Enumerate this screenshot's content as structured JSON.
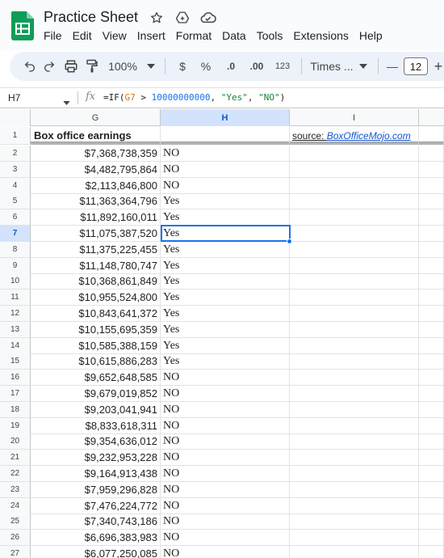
{
  "app": {
    "doc_title": "Practice Sheet",
    "menu": [
      "File",
      "Edit",
      "View",
      "Insert",
      "Format",
      "Data",
      "Tools",
      "Extensions",
      "Help"
    ]
  },
  "toolbar": {
    "zoom": "100%",
    "currency": "$",
    "percent": "%",
    "decrease_decimal": ".0",
    "increase_decimal": ".00",
    "number_format": "123",
    "font": "Times ...",
    "font_size": "12",
    "minus": "—",
    "plus": "+"
  },
  "formula_bar": {
    "cell_ref": "H7",
    "fx": "fx",
    "formula_parts": {
      "p1": "=IF(",
      "ref": "G7",
      "p2": " > ",
      "num": "10000000000",
      "p3": ", ",
      "str1": "\"Yes\"",
      "p4": ", ",
      "str2": "\"NO\"",
      "p5": ")"
    }
  },
  "columns": [
    "G",
    "H",
    "I"
  ],
  "active_column": "H",
  "active_row": "7",
  "header_row": {
    "num": "1",
    "g": "Box office earnings",
    "h": "",
    "i_label": "source: ",
    "i_link": "BoxOfficeMojo.com"
  },
  "rows": [
    {
      "num": "2",
      "g": "$7,368,738,359",
      "h": "NO"
    },
    {
      "num": "3",
      "g": "$4,482,795,864",
      "h": "NO"
    },
    {
      "num": "4",
      "g": "$2,113,846,800",
      "h": "NO"
    },
    {
      "num": "5",
      "g": "$11,363,364,796",
      "h": "Yes"
    },
    {
      "num": "6",
      "g": "$11,892,160,011",
      "h": "Yes"
    },
    {
      "num": "7",
      "g": "$11,075,387,520",
      "h": "Yes"
    },
    {
      "num": "8",
      "g": "$11,375,225,455",
      "h": "Yes"
    },
    {
      "num": "9",
      "g": "$11,148,780,747",
      "h": "Yes"
    },
    {
      "num": "10",
      "g": "$10,368,861,849",
      "h": "Yes"
    },
    {
      "num": "11",
      "g": "$10,955,524,800",
      "h": "Yes"
    },
    {
      "num": "12",
      "g": "$10,843,641,372",
      "h": "Yes"
    },
    {
      "num": "13",
      "g": "$10,155,695,359",
      "h": "Yes"
    },
    {
      "num": "14",
      "g": "$10,585,388,159",
      "h": "Yes"
    },
    {
      "num": "15",
      "g": "$10,615,886,283",
      "h": "Yes"
    },
    {
      "num": "16",
      "g": "$9,652,648,585",
      "h": "NO"
    },
    {
      "num": "17",
      "g": "$9,679,019,852",
      "h": "NO"
    },
    {
      "num": "18",
      "g": "$9,203,041,941",
      "h": "NO"
    },
    {
      "num": "19",
      "g": "$8,833,618,311",
      "h": "NO"
    },
    {
      "num": "20",
      "g": "$9,354,636,012",
      "h": "NO"
    },
    {
      "num": "21",
      "g": "$9,232,953,228",
      "h": "NO"
    },
    {
      "num": "22",
      "g": "$9,164,913,438",
      "h": "NO"
    },
    {
      "num": "23",
      "g": "$7,959,296,828",
      "h": "NO"
    },
    {
      "num": "24",
      "g": "$7,476,224,772",
      "h": "NO"
    },
    {
      "num": "25",
      "g": "$7,340,743,186",
      "h": "NO"
    },
    {
      "num": "26",
      "g": "$6,696,383,983",
      "h": "NO"
    },
    {
      "num": "27",
      "g": "$6,077,250,085",
      "h": "NO"
    }
  ]
}
